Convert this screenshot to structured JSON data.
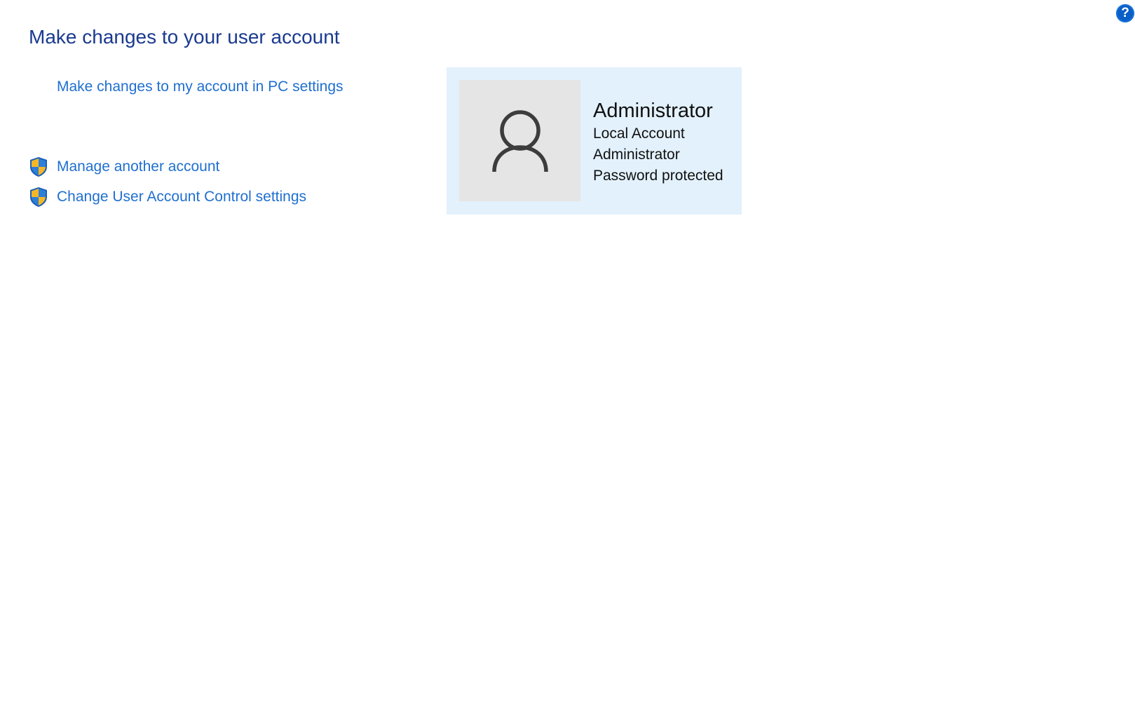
{
  "help": {
    "icon": "help-icon",
    "glyph": "?"
  },
  "header": {
    "title": "Make changes to your user account"
  },
  "links": {
    "pc_settings": "Make changes to my account in PC settings"
  },
  "tasks": [
    {
      "icon": "uac-shield-icon",
      "label": "Manage another account"
    },
    {
      "icon": "uac-shield-icon",
      "label": "Change User Account Control settings"
    }
  ],
  "account": {
    "avatar_icon": "user-avatar-icon",
    "name": "Administrator",
    "type": "Local Account",
    "role": "Administrator",
    "password_status": "Password protected"
  },
  "colors": {
    "title": "#1a3a8f",
    "link": "#1f6fcf",
    "card_background": "#e3f1fc",
    "avatar_background": "#e5e5e5",
    "help_button": "#0a5fc7"
  }
}
